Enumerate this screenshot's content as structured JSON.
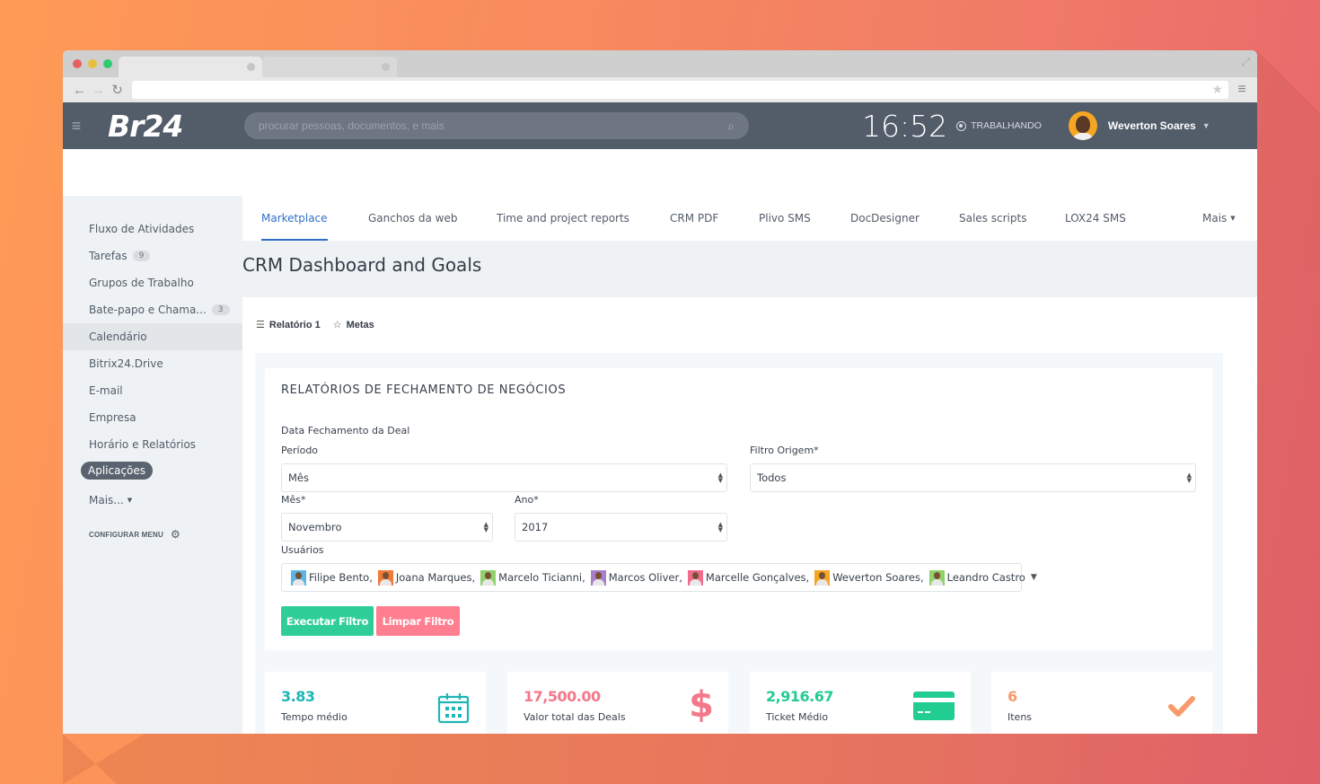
{
  "browser": {
    "tabs": [
      {
        "label": ""
      },
      {
        "label": ""
      }
    ],
    "url": ""
  },
  "topbar": {
    "logo": "Br24",
    "search_placeholder": "procurar pessoas, documentos, e mais",
    "clock": "16:52",
    "status": "TRABALHANDO",
    "user_name": "Weverton Soares"
  },
  "sidebar": {
    "items": [
      {
        "label": "Fluxo de Atividades"
      },
      {
        "label": "Tarefas",
        "badge": "9"
      },
      {
        "label": "Grupos de Trabalho"
      },
      {
        "label": "Bate-papo e Chama...",
        "badge": "3"
      },
      {
        "label": "Calendário"
      },
      {
        "label": "Bitrix24.Drive"
      },
      {
        "label": "E-mail"
      },
      {
        "label": "Empresa"
      },
      {
        "label": "Horário e Relatórios"
      },
      {
        "label": "Aplicações",
        "active": true
      },
      {
        "label": "Mais..."
      }
    ],
    "config_label": "CONFIGURAR MENU"
  },
  "tabs": [
    {
      "label": "Marketplace",
      "active": true
    },
    {
      "label": "Ganchos da web"
    },
    {
      "label": "Time and project reports"
    },
    {
      "label": "CRM PDF"
    },
    {
      "label": "Plivo SMS"
    },
    {
      "label": "DocDesigner"
    },
    {
      "label": "Sales scripts"
    },
    {
      "label": "LOX24 SMS"
    },
    {
      "label": "Mais"
    }
  ],
  "page": {
    "title": "CRM Dashboard and Goals",
    "subnav": [
      {
        "label": "Relatório 1",
        "icon": "list-icon"
      },
      {
        "label": "Metas",
        "icon": "star-icon"
      }
    ]
  },
  "report": {
    "title": "RELATÓRIOS DE FECHAMENTO DE NEGÓCIOS",
    "section_label": "Data Fechamento da Deal",
    "periodo": {
      "label": "Período",
      "value": "Mês"
    },
    "filtro_origem": {
      "label": "Filtro Origem*",
      "value": "Todos"
    },
    "mes": {
      "label": "Mês*",
      "value": "Novembro"
    },
    "ano": {
      "label": "Ano*",
      "value": "2017"
    },
    "usuarios": {
      "label": "Usuários",
      "selected": [
        {
          "name": "Filipe Bento,",
          "color": "#5bb6e8"
        },
        {
          "name": "Joana Marques,",
          "color": "#f07a3a"
        },
        {
          "name": "Marcelo Ticianni,",
          "color": "#8fd16b"
        },
        {
          "name": "Marcos Oliver,",
          "color": "#a87fc9"
        },
        {
          "name": "Marcelle Gonçalves,",
          "color": "#f06b8c"
        },
        {
          "name": "Weverton Soares,",
          "color": "#f5a623"
        },
        {
          "name": "Leandro Castro",
          "color": "#8fd16b"
        }
      ]
    },
    "buttons": {
      "run": "Executar Filtro",
      "clear": "Limpar Filtro"
    }
  },
  "stats": [
    {
      "value": "3.83",
      "caption": "Tempo médio",
      "color": "#1fb5b5",
      "icon": "calendar-icon"
    },
    {
      "value": "17,500.00",
      "caption": "Valor total das Deals",
      "color": "#f4778a",
      "icon": "dollar-icon"
    },
    {
      "value": "2,916.67",
      "caption": "Ticket Médio",
      "color": "#21cd91",
      "icon": "credit-card-icon"
    },
    {
      "value": "6",
      "caption": "Itens",
      "color": "#f99a6a",
      "icon": "checkmark-icon"
    }
  ]
}
